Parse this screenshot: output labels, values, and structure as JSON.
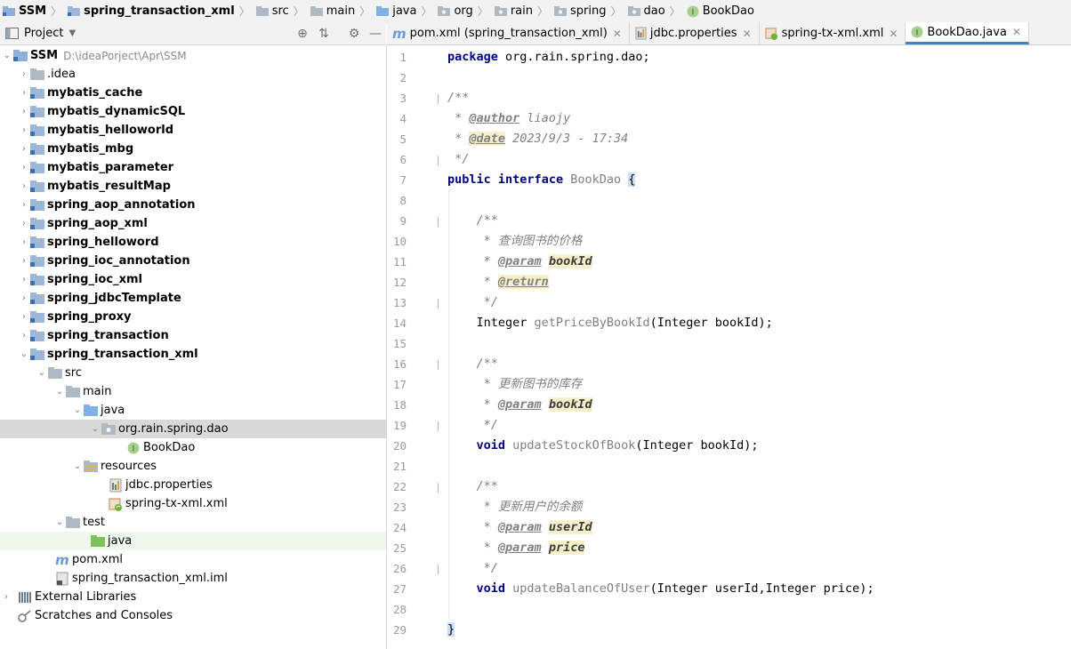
{
  "breadcrumbs": [
    "SSM",
    "spring_transaction_xml",
    "src",
    "main",
    "java",
    "org",
    "rain",
    "spring",
    "dao",
    "BookDao"
  ],
  "project_panel": {
    "title": "Project",
    "dropdown_icon": "caret-down-icon"
  },
  "tree": [
    {
      "label": "SSM",
      "sub": "D:\\ideaPorject\\Apr\\SSM",
      "bold": true
    },
    {
      "label": ".idea"
    },
    {
      "label": "mybatis_cache",
      "bold": true
    },
    {
      "label": "mybatis_dynamicSQL",
      "bold": true
    },
    {
      "label": "mybatis_helloworld",
      "bold": true
    },
    {
      "label": "mybatis_mbg",
      "bold": true
    },
    {
      "label": "mybatis_parameter",
      "bold": true
    },
    {
      "label": "mybatis_resultMap",
      "bold": true
    },
    {
      "label": "spring_aop_annotation",
      "bold": true
    },
    {
      "label": "spring_aop_xml",
      "bold": true
    },
    {
      "label": "spring_helloword",
      "bold": true
    },
    {
      "label": "spring_ioc_annotation",
      "bold": true
    },
    {
      "label": "spring_ioc_xml",
      "bold": true
    },
    {
      "label": "spring_jdbcTemplate",
      "bold": true
    },
    {
      "label": "spring_proxy",
      "bold": true
    },
    {
      "label": "spring_transaction",
      "bold": true
    },
    {
      "label": "spring_transaction_xml",
      "bold": true
    },
    {
      "label": "src"
    },
    {
      "label": "main"
    },
    {
      "label": "java"
    },
    {
      "label": "org.rain.spring.dao",
      "selected": true
    },
    {
      "label": "BookDao"
    },
    {
      "label": "resources"
    },
    {
      "label": "jdbc.properties"
    },
    {
      "label": "spring-tx-xml.xml"
    },
    {
      "label": "test"
    },
    {
      "label": "java",
      "highlighted": true
    },
    {
      "label": "pom.xml"
    },
    {
      "label": "spring_transaction_xml.iml"
    },
    {
      "label": "External Libraries"
    },
    {
      "label": "Scratches and Consoles"
    }
  ],
  "tabs": [
    {
      "label": "pom.xml (spring_transaction_xml)",
      "icon": "maven-icon"
    },
    {
      "label": "jdbc.properties",
      "icon": "properties-file-icon"
    },
    {
      "label": "spring-tx-xml.xml",
      "icon": "spring-xml-icon"
    },
    {
      "label": "BookDao.java",
      "icon": "interface-icon",
      "active": true
    }
  ],
  "line_numbers": [
    "1",
    "2",
    "3",
    "4",
    "5",
    "6",
    "7",
    "8",
    "9",
    "10",
    "11",
    "12",
    "13",
    "14",
    "15",
    "16",
    "17",
    "18",
    "19",
    "20",
    "21",
    "22",
    "23",
    "24",
    "25",
    "26",
    "27",
    "28",
    "29"
  ],
  "code": {
    "l1_kw": "package",
    "l1_rest": " org.rain.spring.dao;",
    "l3": "/**",
    "l4_star": " * ",
    "l4_tag": "@author",
    "l4_rest": " liaojy",
    "l5_star": " * ",
    "l5_tag": "@date",
    "l5_rest": " 2023/9/3 - 17:34",
    "l6": " */",
    "l7_kw1": "public",
    "l7_kw2": "interface",
    "l7_name": "BookDao",
    "l7_brace": "{",
    "l9": "    /**",
    "l10": "     * 查询图书的价格",
    "l11_star": "     * ",
    "l11_tag": "@param",
    "l11_p": "bookId",
    "l12_star": "     * ",
    "l12_tag": "@return",
    "l13": "     */",
    "l14_type": "    Integer ",
    "l14_m": "getPriceByBookId",
    "l14_rest": "(Integer bookId);",
    "l16": "    /**",
    "l17": "     * 更新图书的库存",
    "l18_star": "     * ",
    "l18_tag": "@param",
    "l18_p": "bookId",
    "l19": "     */",
    "l20_kw": "void",
    "l20_m": "updateStockOfBook",
    "l20_rest": "(Integer bookId);",
    "l22": "    /**",
    "l23": "     * 更新用户的余额",
    "l24_star": "     * ",
    "l24_tag": "@param",
    "l24_p": "userId",
    "l25_star": "     * ",
    "l25_tag": "@param",
    "l25_p": "price",
    "l26": "     */",
    "l27_kw": "void",
    "l27_m": "updateBalanceOfUser",
    "l27_rest": "(Integer userId,Integer price);",
    "l29": "}"
  },
  "current_line": "7"
}
